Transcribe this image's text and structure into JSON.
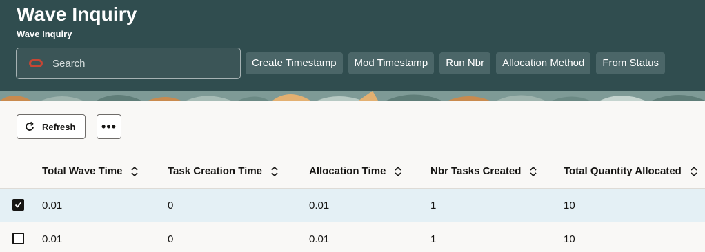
{
  "header": {
    "title": "Wave Inquiry",
    "subtitle": "Wave Inquiry",
    "search_placeholder": "Search",
    "filter_chips": [
      "Create Timestamp",
      "Mod Timestamp",
      "Run Nbr",
      "Allocation Method",
      "From Status"
    ]
  },
  "toolbar": {
    "refresh_label": "Refresh",
    "more_label": "•••"
  },
  "table": {
    "columns": [
      "Total Wave Time",
      "Task Creation Time",
      "Allocation Time",
      "Nbr Tasks Created",
      "Total Quantity Allocated"
    ],
    "rows": [
      {
        "selected": true,
        "cells": [
          "0.01",
          "0",
          "0.01",
          "1",
          "10"
        ]
      },
      {
        "selected": false,
        "cells": [
          "0.01",
          "0",
          "0.01",
          "1",
          "10"
        ]
      }
    ]
  },
  "colors": {
    "header_bg": "#304d4f",
    "chip_bg": "#4b6668",
    "search_icon": "#c74634",
    "selected_row_bg": "#e4f0f5"
  },
  "icons": {
    "search": "oracle-search-icon",
    "refresh": "refresh-icon",
    "sort": "sort-icon",
    "checkbox": "checkbox-icon"
  }
}
